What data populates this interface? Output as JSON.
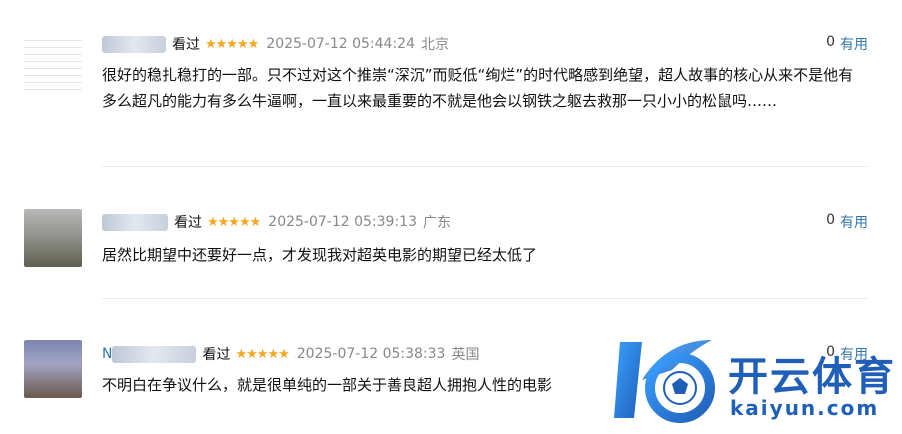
{
  "comments": [
    {
      "name_prefix": "",
      "status": "看过",
      "stars": "★★★★★",
      "time": "2025-07-12 05:44:24",
      "location": "北京",
      "useful_count": "0",
      "useful_label": "有用",
      "content": "很好的稳扎稳打的一部。只不过对这个推崇“深沉”而贬低“绚烂”的时代略感到绝望，超人故事的核心从来不是他有多么超凡的能力有多么牛逼啊，一直以来最重要的不就是他会以钢铁之躯去救那一只小小的松鼠吗……"
    },
    {
      "name_prefix": "",
      "status": "看过",
      "stars": "★★★★★",
      "time": "2025-07-12 05:39:13",
      "location": "广东",
      "useful_count": "0",
      "useful_label": "有用",
      "content": "居然比期望中还要好一点，才发现我对超英电影的期望已经太低了"
    },
    {
      "name_prefix": "N",
      "status": "看过",
      "stars": "★★★★★",
      "time": "2025-07-12 05:38:33",
      "location": "英国",
      "useful_count": "0",
      "useful_label": "有用",
      "content": "不明白在争议什么，就是很单纯的一部关于善良超人拥抱人性的电影"
    }
  ],
  "watermark": {
    "name_cn": "开云体育",
    "name_en": "kaiyun.com"
  },
  "colors": {
    "link": "#3377aa",
    "star": "#f5a623",
    "meta_gray": "#888888",
    "watermark_blue": "#1f5fb8"
  }
}
